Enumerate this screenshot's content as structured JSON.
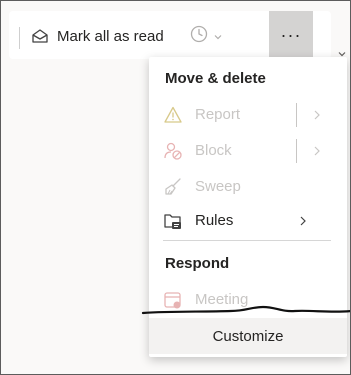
{
  "toolbar": {
    "mark_all_read_label": "Mark all as read",
    "more_label": "···"
  },
  "menu": {
    "move_delete_heading": "Move & delete",
    "report_label": "Report",
    "block_label": "Block",
    "sweep_label": "Sweep",
    "rules_label": "Rules",
    "respond_heading": "Respond",
    "meeting_label": "Meeting",
    "customize_label": "Customize"
  },
  "colors": {
    "text": "#252423",
    "disabled_text": "#c8c6c4",
    "disabled_icon_red": "#e7b3b3",
    "more_button_bg": "#d4d3d2",
    "customize_bg": "#f3f2f1"
  },
  "icons": {
    "mark_read": "envelope-open-icon",
    "snooze": "clock-icon",
    "report": "warning-icon",
    "block": "block-user-icon",
    "sweep": "broom-icon",
    "rules": "folder-rules-icon",
    "meeting": "calendar-icon"
  }
}
